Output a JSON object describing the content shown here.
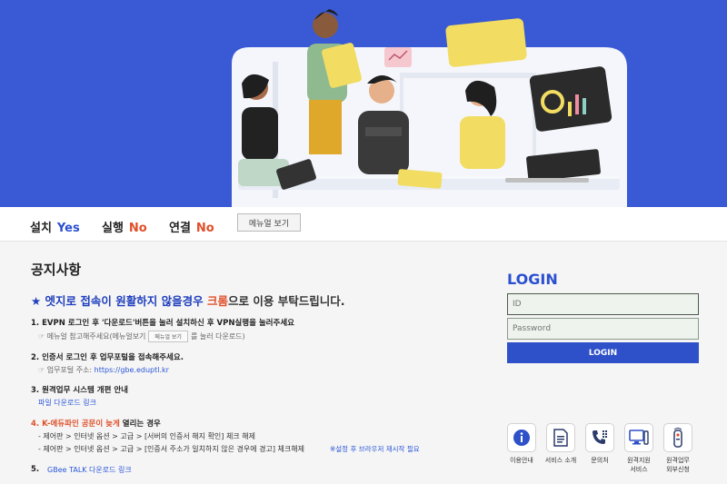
{
  "status": {
    "install_label": "설치",
    "install_value": "Yes",
    "run_label": "실행",
    "run_value": "No",
    "connect_label": "연결",
    "connect_value": "No",
    "manual_button": "메뉴얼 보기"
  },
  "notice": {
    "title": "공지사항",
    "headline_prefix": "★ 엣지로 접속이 원활하지 않을경우",
    "headline_browser": "크롬",
    "headline_suffix": "으로 이용 부탁드립니다.",
    "item1": "1. EVPN 로그인 후 '다운로드'버튼을 눌러 설치하신 후 VPN실행을 눌러주세요",
    "item1_sub_prefix": "☞ 메뉴얼 참고해주세요(메뉴얼보기",
    "item1_sub_button": "메뉴얼 보기",
    "item1_sub_suffix": "를 눌러 다운로드)",
    "item2": "2. 인증서 로그인 후 업무포털을 접속해주세요.",
    "item2_sub_prefix": "☞ 업무포털 주소:",
    "item2_sub_link": "https://gbe.eduptl.kr",
    "item3": "3. 원격업무 시스템 개편 안내",
    "item3_link": "파일 다운로드 링크",
    "item4_prefix": "4.",
    "item4_highlight": "K-에듀파인 공문이 늦게",
    "item4_suffix": "열리는 경우",
    "item4_sub1": "- 제어판 > 인터넷 옵션 > 고급 > [서버의 인증서 해지 확인] 체크 해제",
    "item4_sub2": "- 제어판 > 인터넷 옵션 > 고급 > [인증서 주소가 일치하지 않은 경우에 경고] 체크해제",
    "item4_note": "※설정 후 브라우저 재시작 필요",
    "item5_num": "5.",
    "item5_link": "GBee TALK 다운로드 링크"
  },
  "login": {
    "title": "LOGIN",
    "id_placeholder": "ID",
    "password_placeholder": "Password",
    "button": "LOGIN"
  },
  "quick_links": [
    {
      "label": "이용안내",
      "icon": "info-icon"
    },
    {
      "label": "서비스 소개",
      "icon": "document-icon"
    },
    {
      "label": "문의처",
      "icon": "phone-icon"
    },
    {
      "label": "원격지원",
      "label2": "서비스",
      "icon": "monitor-icon"
    },
    {
      "label": "원격업무",
      "label2": "외부신청",
      "icon": "remote-control-icon"
    }
  ],
  "colors": {
    "brand_blue": "#2e51c9",
    "hero_blue": "#3a59d4",
    "accent_orange": "#e0502a"
  }
}
